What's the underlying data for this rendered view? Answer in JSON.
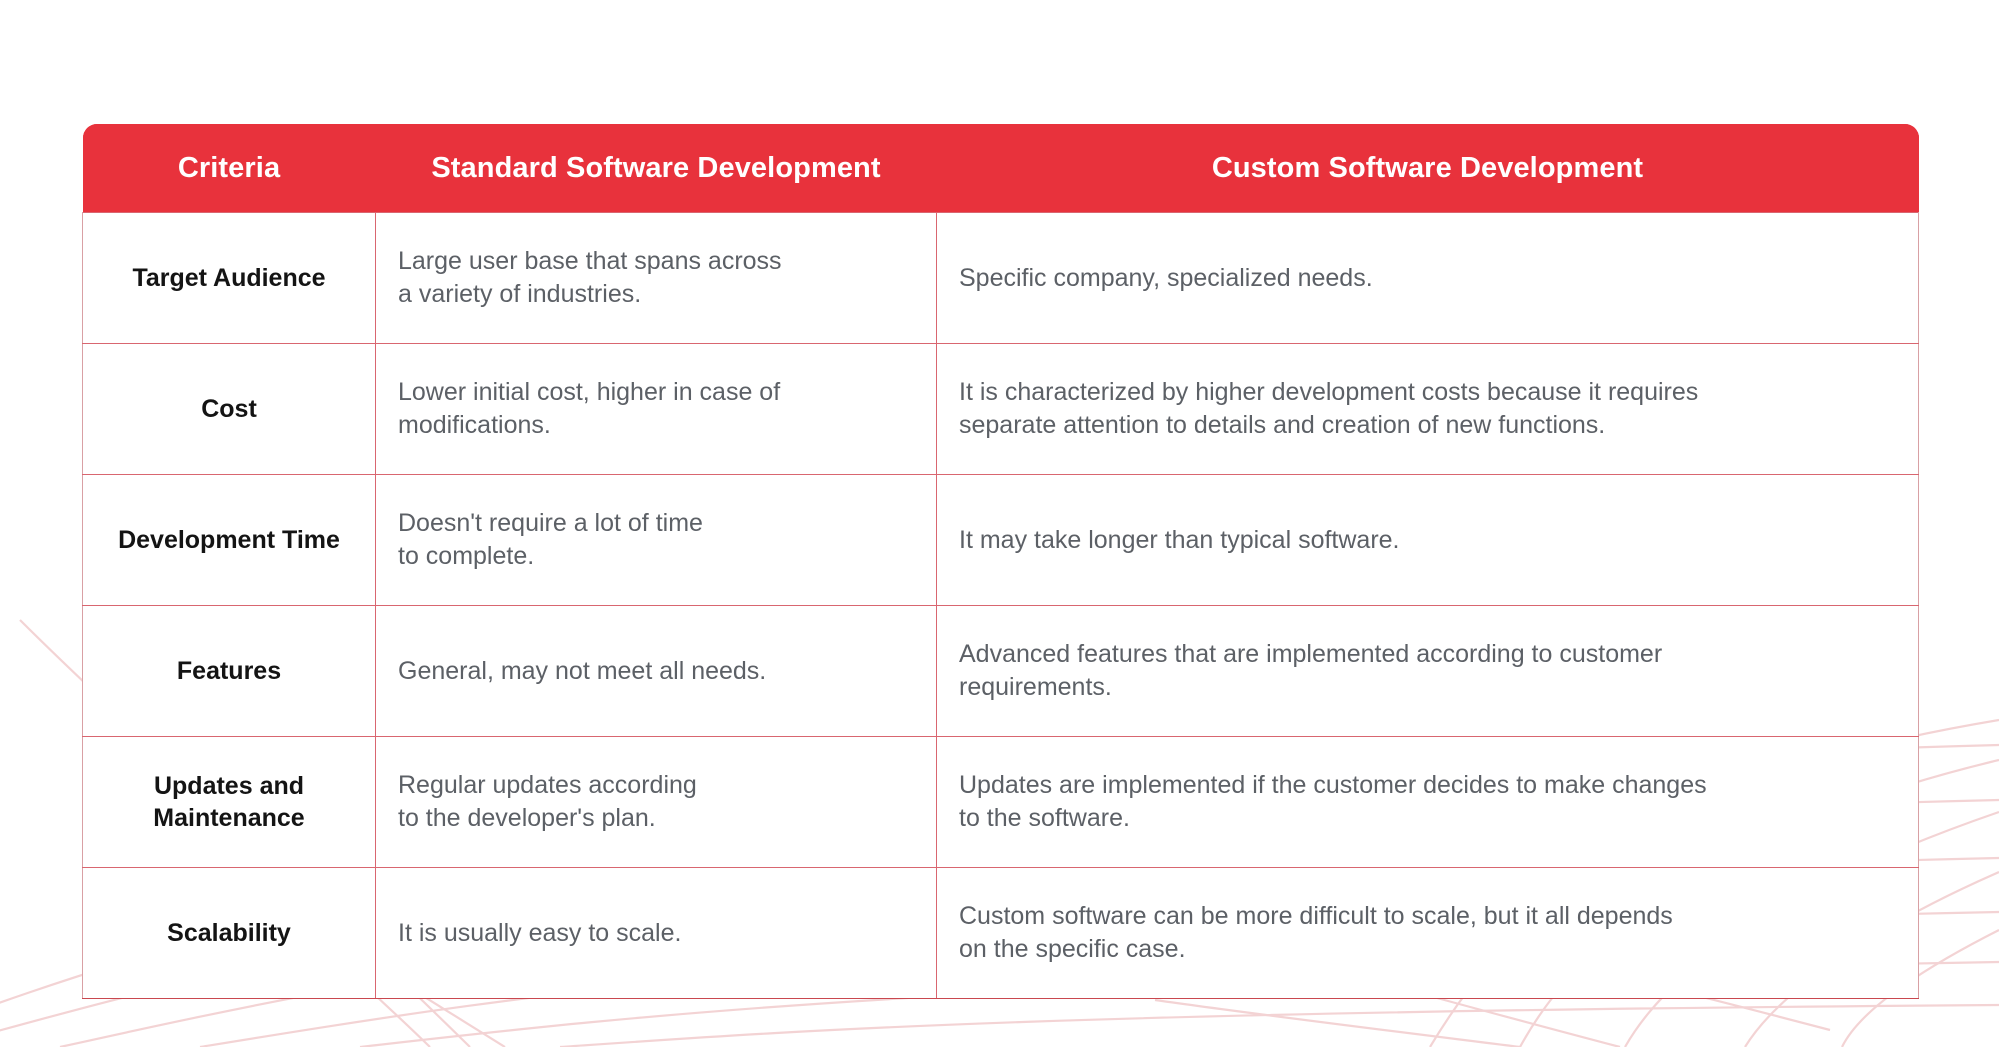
{
  "table": {
    "columns": [
      {
        "key": "criteria",
        "label": "Criteria"
      },
      {
        "key": "standard",
        "label": "Standard Software Development"
      },
      {
        "key": "custom",
        "label": "Custom Software Development"
      }
    ],
    "rows": [
      {
        "criteria": "Target Audience",
        "standard": "Large user base that spans across\na variety of industries.",
        "custom": "Specific company, specialized needs."
      },
      {
        "criteria": "Cost",
        "standard": "Lower initial cost, higher in case of\nmodifications.",
        "custom": "It is characterized by higher development costs because it requires\nseparate attention to details and creation of new functions."
      },
      {
        "criteria": "Development Time",
        "standard": "Doesn't require a lot of time\nto complete.",
        "custom": "It may take longer than typical software."
      },
      {
        "criteria": "Features",
        "standard": "General, may not meet all needs.",
        "custom": "Advanced features that are implemented according to customer\nrequirements."
      },
      {
        "criteria": "Updates and\nMaintenance",
        "standard": "Regular updates according\nto the developer's plan.",
        "custom": "Updates are implemented if the customer decides to make changes\nto the software."
      },
      {
        "criteria": "Scalability",
        "standard": "It is usually easy to scale.",
        "custom": "Custom software can be more difficult to scale, but it all depends\non the specific case."
      }
    ]
  },
  "colors": {
    "header_background": "#E8323C",
    "header_text": "#FFFFFF",
    "criteria_text": "#141414",
    "body_text": "#5C6066",
    "grid_line": "#D96670",
    "decoration_line": "#F3D3D4",
    "page_background": "#FFFFFF"
  }
}
